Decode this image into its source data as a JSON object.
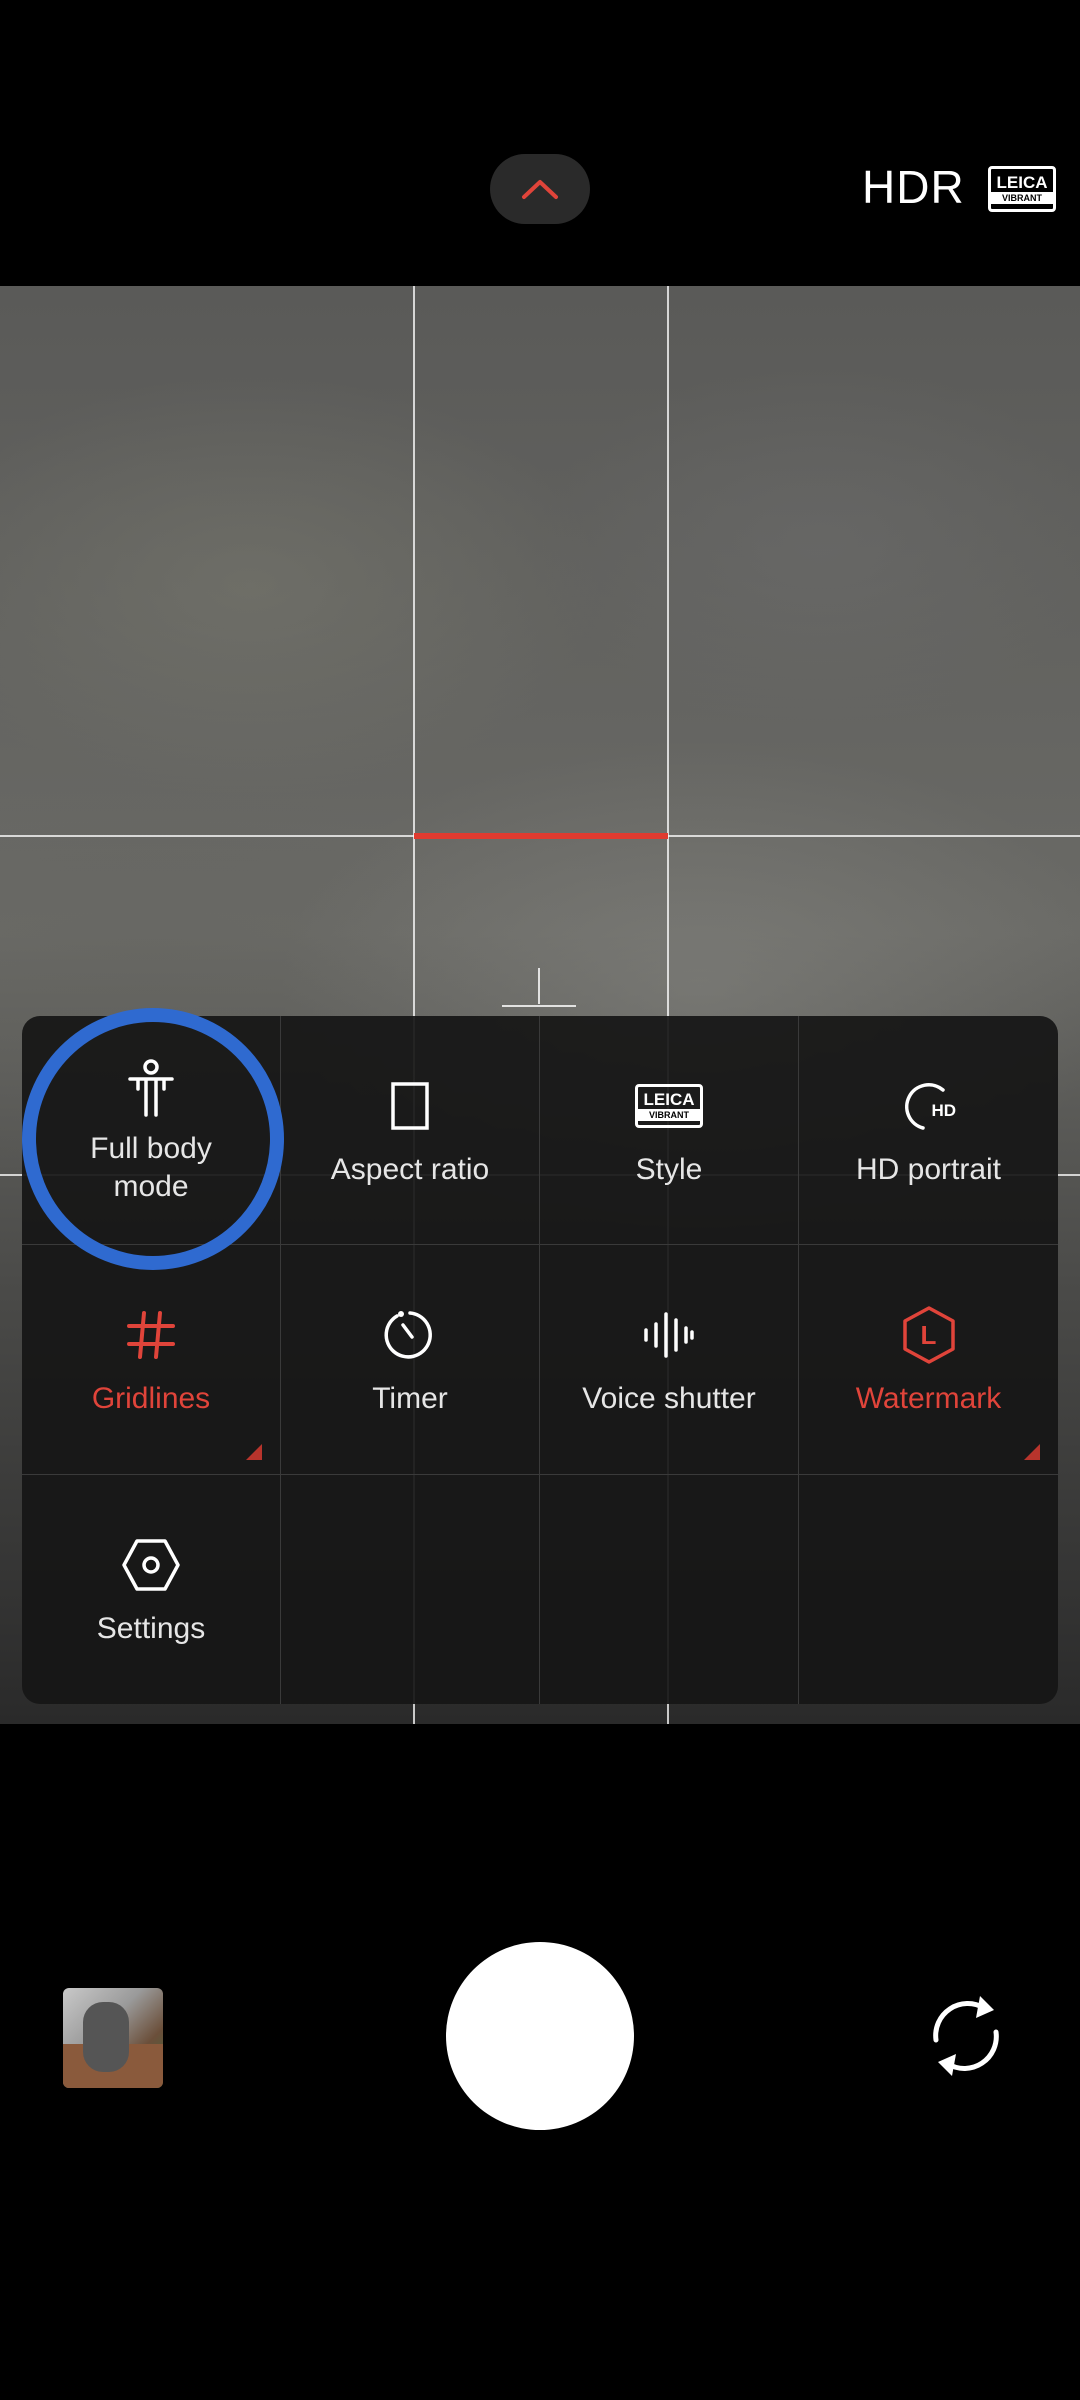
{
  "top_bar": {
    "hdr_label": "HDR",
    "leica_badge": {
      "brand": "LEICA",
      "style": "VIBRANT"
    }
  },
  "quick_settings": {
    "items": [
      {
        "label": "Full body mode",
        "icon": "full-body-icon",
        "active": false
      },
      {
        "label": "Aspect ratio",
        "icon": "aspect-ratio-icon",
        "active": false
      },
      {
        "label": "Style",
        "icon": "leica-style-icon",
        "badge_brand": "LEICA",
        "badge_style": "VIBRANT",
        "active": false
      },
      {
        "label": "HD portrait",
        "icon": "hd-portrait-icon",
        "badge": "HD",
        "active": false
      },
      {
        "label": "Gridlines",
        "icon": "gridlines-icon",
        "active": true
      },
      {
        "label": "Timer",
        "icon": "timer-icon",
        "active": false
      },
      {
        "label": "Voice shutter",
        "icon": "voice-shutter-icon",
        "active": false
      },
      {
        "label": "Watermark",
        "icon": "watermark-icon",
        "badge": "L",
        "active": true
      },
      {
        "label": "Settings",
        "icon": "settings-icon",
        "active": false
      }
    ]
  },
  "colors": {
    "accent_red": "#e0443a",
    "highlight_blue": "#2f6ad0",
    "panel_bg": "#161616"
  }
}
